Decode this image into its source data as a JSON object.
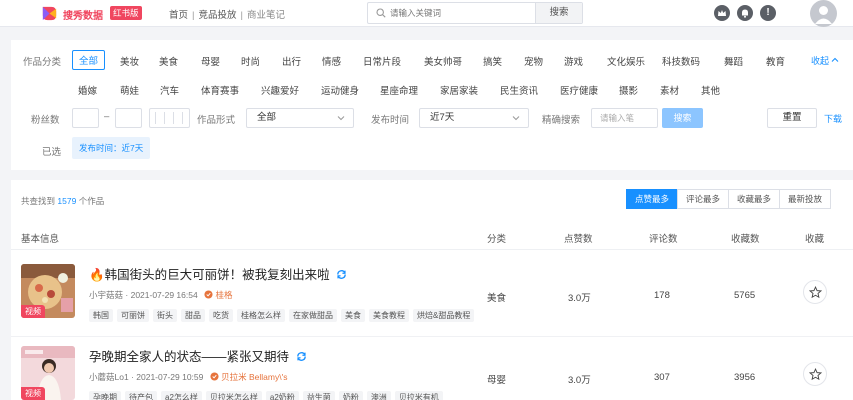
{
  "header": {
    "brand": "搜秀数据",
    "brand_badge": "红书版",
    "breadcrumb": [
      "首页",
      "竞品投放",
      "商业笔记"
    ],
    "search_placeholder": "请输入关键词",
    "search_button": "搜索"
  },
  "filters": {
    "category_label": "作品分类",
    "categories_row1": [
      "全部",
      "美妆",
      "美食",
      "母婴",
      "时尚",
      "出行",
      "情感",
      "日常片段",
      "美女帅哥",
      "搞笑",
      "宠物",
      "游戏",
      "文化娱乐",
      "科技数码",
      "舞蹈",
      "教育"
    ],
    "categories_row2": [
      "婚嫁",
      "萌娃",
      "汽车",
      "体育赛事",
      "兴趣爱好",
      "运动健身",
      "星座命理",
      "家居家装",
      "民生资讯",
      "医疗健康",
      "摄影",
      "素材",
      "其他"
    ],
    "collapse_label": "收起",
    "fans_label": "粉丝数",
    "fans_sep": "–",
    "form_label": "作品形式",
    "form_value": "全部",
    "time_label": "发布时间",
    "time_value": "近7天",
    "precise_label": "精确搜索",
    "precise_placeholder": "请输入笔",
    "precise_button": "搜索",
    "reset_button": "重置",
    "download_label": "下载",
    "selected_label": "已选",
    "selected_chip": "发布时间：近7天"
  },
  "results": {
    "count_prefix": "共查找到",
    "count": "1579",
    "count_suffix": "个作品",
    "sort_options": [
      "点赞最多",
      "评论最多",
      "收藏最多",
      "最新投放"
    ],
    "columns": [
      "基本信息",
      "分类",
      "点赞数",
      "评论数",
      "收藏数",
      "收藏"
    ],
    "rows": [
      {
        "title": "🔥韩国街头的巨大可丽饼！被我复刻出来啦",
        "author": "小宇菇菇",
        "date": "2021-07-29 16:54",
        "brand": "桂格",
        "video_tag": "视频",
        "tags": [
          "韩国",
          "可丽饼",
          "街头",
          "甜品",
          "吃货",
          "桂格怎么样",
          "在家做甜品",
          "美食",
          "美食教程",
          "烘焙&甜品教程"
        ],
        "category": "美食",
        "likes": "3.0万",
        "comments": "178",
        "collects": "5765"
      },
      {
        "title": "孕晚期全家人的状态——紧张又期待",
        "author": "小蘑菇Lo1",
        "date": "2021-07-29 10:59",
        "brand": "贝拉米 Bellamy\\'s",
        "video_tag": "视频",
        "tags": [
          "孕晚期",
          "待产包",
          "a2怎么样",
          "贝拉米怎么样",
          "a2奶粉",
          "益生菌",
          "奶粉",
          "澳洲",
          "贝拉米有机"
        ],
        "category": "母婴",
        "likes": "3.0万",
        "comments": "307",
        "collects": "3956"
      }
    ]
  },
  "colors": {
    "accent": "#1890ff",
    "brand": "#f0465f"
  }
}
